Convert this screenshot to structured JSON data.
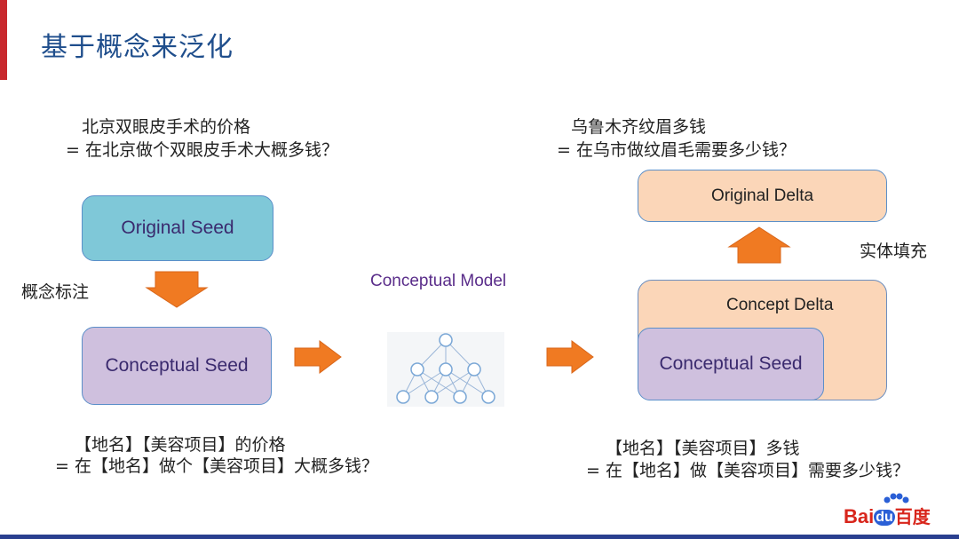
{
  "title": "基于概念来泛化",
  "left": {
    "query_line1": "北京双眼皮手术的价格",
    "query_line2": "= 在北京做个双眼皮手术大概多钱？",
    "original_seed": "Original Seed",
    "step_label": "概念标注",
    "conceptual_seed": "Conceptual Seed",
    "template_line1": "【地名】【美容项目】的价格",
    "template_line2": "= 在【地名】做个【美容项目】大概多钱？"
  },
  "middle": {
    "model_label": "Conceptual Model"
  },
  "right": {
    "query_line1": "乌鲁木齐纹眉多钱",
    "query_line2": "= 在乌市做纹眉毛需要多少钱？",
    "original_delta": "Original Delta",
    "step_label": "实体填充",
    "concept_delta": "Concept Delta",
    "conceptual_seed": "Conceptual Seed",
    "template_line1": "【地名】【美容项目】多钱",
    "template_line2": "= 在【地名】做【美容项目】需要多少钱？"
  },
  "logo": {
    "text_bai": "Bai",
    "text_du": "du",
    "text_cn": "百度"
  },
  "colors": {
    "title": "#1f4e8c",
    "accent": "#c8282d",
    "arrow": "#f07a22",
    "model_node": "#7aa7d6"
  }
}
